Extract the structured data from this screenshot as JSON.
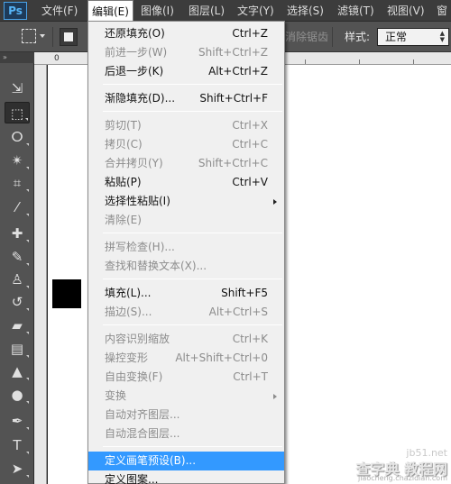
{
  "app": {
    "logo": "Ps"
  },
  "menubar": {
    "items": [
      {
        "label": "文件(F)"
      },
      {
        "label": "编辑(E)"
      },
      {
        "label": "图像(I)"
      },
      {
        "label": "图层(L)"
      },
      {
        "label": "文字(Y)"
      },
      {
        "label": "选择(S)"
      },
      {
        "label": "滤镜(T)"
      },
      {
        "label": "视图(V)"
      },
      {
        "label": "窗"
      }
    ],
    "active": "编辑(E)"
  },
  "options": {
    "antialias_label": "消除锯齿",
    "style_label": "样式:",
    "style_value": "正常"
  },
  "toolbox": {
    "header": "»",
    "tools": [
      {
        "icon": "move-icon",
        "glyph": "⇲"
      },
      {
        "icon": "rect-marquee-icon",
        "glyph": "⬚",
        "selected": true
      },
      {
        "icon": "lasso-icon",
        "glyph": "ⵔ"
      },
      {
        "icon": "magic-wand-icon",
        "glyph": "✴"
      },
      {
        "icon": "crop-icon",
        "glyph": "⌗"
      },
      {
        "icon": "eyedropper-icon",
        "glyph": "⁄"
      },
      {
        "icon": "healing-brush-icon",
        "glyph": "✚"
      },
      {
        "icon": "brush-icon",
        "glyph": "✎"
      },
      {
        "icon": "clone-stamp-icon",
        "glyph": "♙"
      },
      {
        "icon": "history-brush-icon",
        "glyph": "↺"
      },
      {
        "icon": "eraser-icon",
        "glyph": "▰"
      },
      {
        "icon": "gradient-icon",
        "glyph": "▤"
      },
      {
        "icon": "blur-icon",
        "glyph": "▲"
      },
      {
        "icon": "dodge-icon",
        "glyph": "●"
      },
      {
        "icon": "pen-icon",
        "glyph": "✒"
      },
      {
        "icon": "type-icon",
        "glyph": "T"
      },
      {
        "icon": "path-selection-icon",
        "glyph": "➤"
      }
    ]
  },
  "ruler": {
    "zero": "0"
  },
  "edit_menu": {
    "items": [
      {
        "label": "还原填充(O)",
        "shortcut": "Ctrl+Z",
        "disabled": false
      },
      {
        "label": "前进一步(W)",
        "shortcut": "Shift+Ctrl+Z",
        "disabled": true
      },
      {
        "label": "后退一步(K)",
        "shortcut": "Alt+Ctrl+Z",
        "disabled": false
      },
      {
        "separator": true
      },
      {
        "label": "渐隐填充(D)...",
        "shortcut": "Shift+Ctrl+F",
        "disabled": false
      },
      {
        "separator": true
      },
      {
        "label": "剪切(T)",
        "shortcut": "Ctrl+X",
        "disabled": true
      },
      {
        "label": "拷贝(C)",
        "shortcut": "Ctrl+C",
        "disabled": true
      },
      {
        "label": "合并拷贝(Y)",
        "shortcut": "Shift+Ctrl+C",
        "disabled": true
      },
      {
        "label": "粘贴(P)",
        "shortcut": "Ctrl+V",
        "disabled": false
      },
      {
        "label": "选择性粘贴(I)",
        "shortcut": "",
        "submenu": true,
        "disabled": false
      },
      {
        "label": "清除(E)",
        "shortcut": "",
        "disabled": true
      },
      {
        "separator": true
      },
      {
        "label": "拼写检查(H)...",
        "shortcut": "",
        "disabled": true
      },
      {
        "label": "查找和替换文本(X)...",
        "shortcut": "",
        "disabled": true
      },
      {
        "separator": true
      },
      {
        "label": "填充(L)...",
        "shortcut": "Shift+F5",
        "disabled": false
      },
      {
        "label": "描边(S)...",
        "shortcut": "Alt+Ctrl+S",
        "disabled": true
      },
      {
        "separator": true
      },
      {
        "label": "内容识别缩放",
        "shortcut": "Ctrl+K",
        "disabled": true
      },
      {
        "label": "操控变形",
        "shortcut": "Alt+Shift+Ctrl+0",
        "disabled": true
      },
      {
        "label": "自由变换(F)",
        "shortcut": "Ctrl+T",
        "disabled": true
      },
      {
        "label": "变换",
        "shortcut": "",
        "submenu": true,
        "disabled": true
      },
      {
        "label": "自动对齐图层...",
        "shortcut": "",
        "disabled": true
      },
      {
        "label": "自动混合图层...",
        "shortcut": "",
        "disabled": true
      },
      {
        "separator": true
      },
      {
        "label": "定义画笔预设(B)...",
        "shortcut": "",
        "disabled": false,
        "highlighted": true
      },
      {
        "label": "定义图案...",
        "shortcut": "",
        "disabled": false
      }
    ]
  },
  "watermark": {
    "top": "jb51.net",
    "main": "查字典 教程网",
    "url": "jiaocheng.chazidian.com"
  }
}
